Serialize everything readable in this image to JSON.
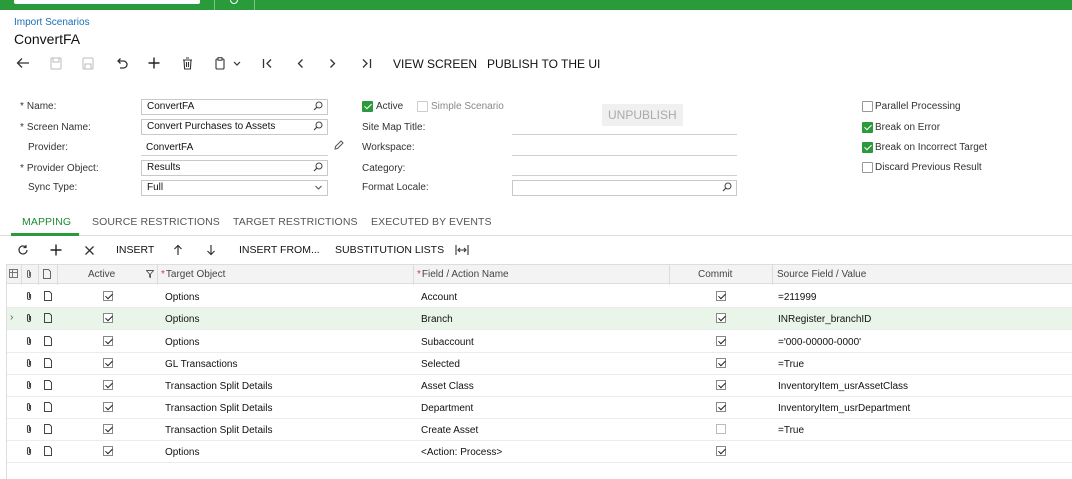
{
  "breadcrumb": "Import Scenarios",
  "page_title": "ConvertFA",
  "toolbar": {
    "view_screen": "VIEW SCREEN",
    "publish": "PUBLISH TO THE UI",
    "unpublish": "UNPUBLISH"
  },
  "form": {
    "name_label": "Name:",
    "name_value": "ConvertFA",
    "screen_name_label": "Screen Name:",
    "screen_name_value": "Convert Purchases to Assets",
    "provider_label": "Provider:",
    "provider_value": "ConvertFA",
    "provider_object_label": "Provider Object:",
    "provider_object_value": "Results",
    "sync_type_label": "Sync Type:",
    "sync_type_value": "Full",
    "active_label": "Active",
    "active_checked": true,
    "simple_label": "Simple Scenario",
    "simple_checked": false,
    "site_map_label": "Site Map Title:",
    "workspace_label": "Workspace:",
    "category_label": "Category:",
    "format_locale_label": "Format Locale:",
    "parallel_label": "Parallel Processing",
    "parallel_checked": false,
    "break_error_label": "Break on Error",
    "break_error_checked": true,
    "break_target_label": "Break on Incorrect Target",
    "break_target_checked": true,
    "discard_label": "Discard Previous Result",
    "discard_checked": false
  },
  "tabs": [
    "MAPPING",
    "SOURCE RESTRICTIONS",
    "TARGET RESTRICTIONS",
    "EXECUTED BY EVENTS"
  ],
  "grid_toolbar": {
    "insert": "INSERT",
    "insert_from": "INSERT FROM...",
    "substitution": "SUBSTITUTION LISTS"
  },
  "grid": {
    "headers": {
      "active": "Active",
      "target_object": "Target Object",
      "field_action": "Field / Action Name",
      "commit": "Commit",
      "source": "Source Field / Value"
    },
    "rows": [
      {
        "active": true,
        "target": "Options",
        "field": "Account",
        "commit": true,
        "source": "=211999",
        "selected": false
      },
      {
        "active": true,
        "target": "Options",
        "field": "Branch",
        "commit": true,
        "source": "INRegister_branchID",
        "selected": true
      },
      {
        "active": true,
        "target": "Options",
        "field": "Subaccount",
        "commit": true,
        "source": "='000-00000-0000'",
        "selected": false
      },
      {
        "active": true,
        "target": "GL Transactions",
        "field": "Selected",
        "commit": true,
        "source": "=True",
        "selected": false
      },
      {
        "active": true,
        "target": "Transaction Split Details",
        "field": "Asset Class",
        "commit": true,
        "source": "InventoryItem_usrAssetClass",
        "selected": false
      },
      {
        "active": true,
        "target": "Transaction Split Details",
        "field": "Department",
        "commit": true,
        "source": "InventoryItem_usrDepartment",
        "selected": false
      },
      {
        "active": true,
        "target": "Transaction Split Details",
        "field": "Create Asset",
        "commit": false,
        "source": "=True",
        "selected": false
      },
      {
        "active": true,
        "target": "Options",
        "field": "<Action: Process>",
        "commit": true,
        "source": "",
        "selected": false
      }
    ]
  },
  "colors": {
    "brand": "#2a9b3a",
    "link": "#1a6fb5",
    "selected_row": "#eaf5ea"
  }
}
